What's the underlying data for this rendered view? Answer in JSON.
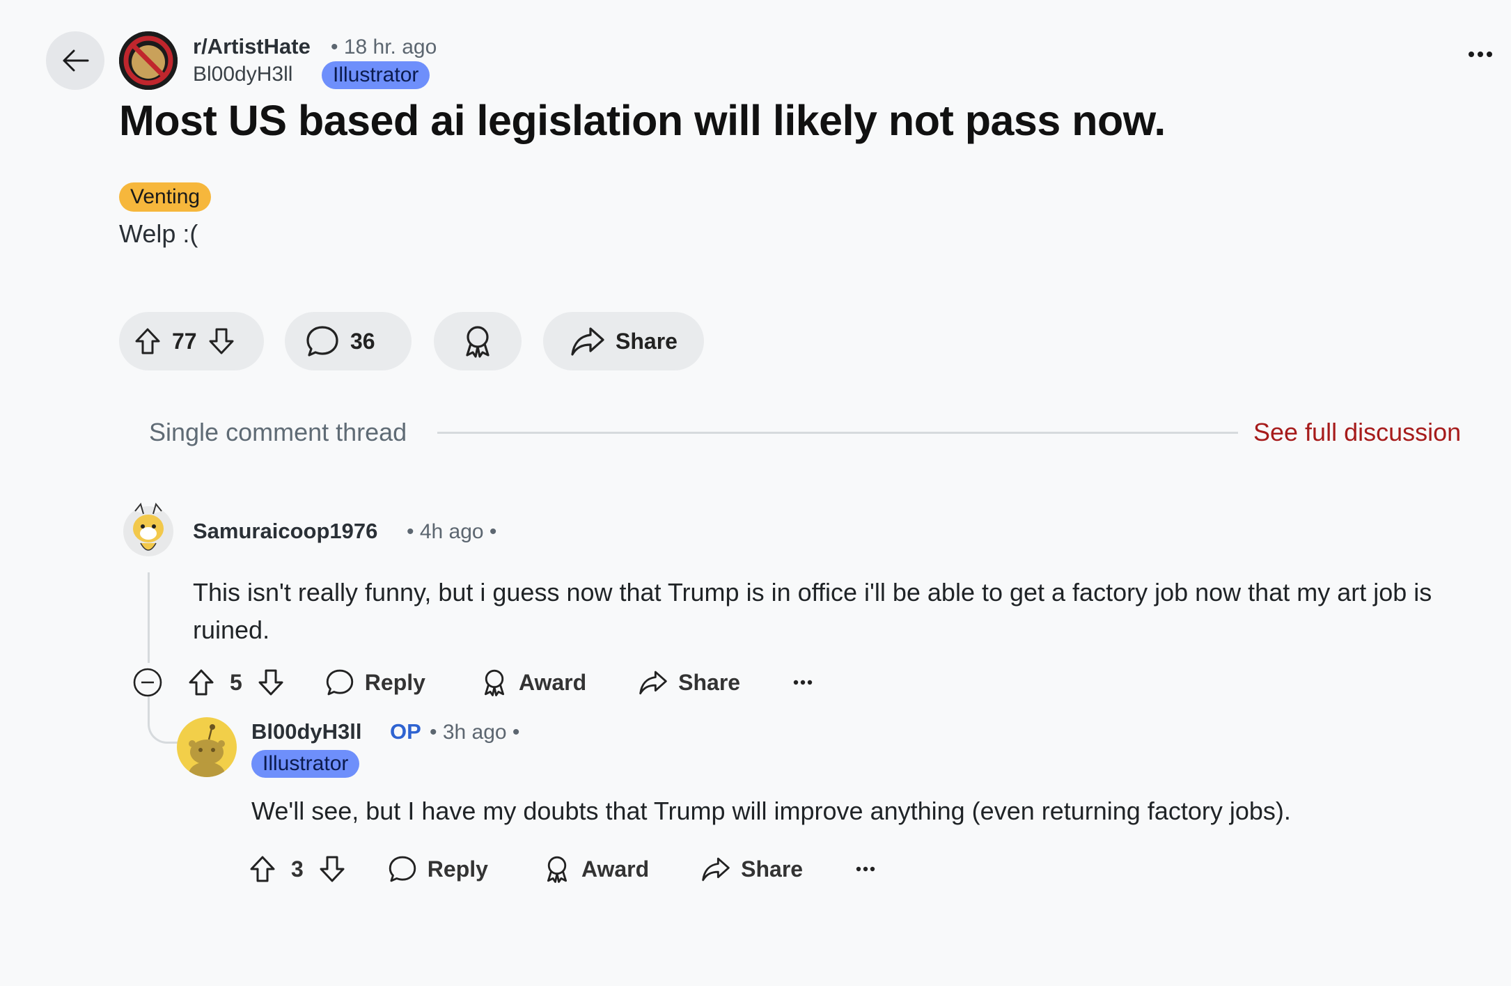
{
  "post": {
    "subreddit": "r/ArtistHate",
    "time": "• 18 hr. ago",
    "author": "Bl00dyH3ll",
    "author_flair": "Illustrator",
    "title": "Most US based ai legislation will likely not pass now.",
    "post_flair": "Venting",
    "body": "Welp :(",
    "votes": "77",
    "comments": "36",
    "share_label": "Share"
  },
  "thread": {
    "label": "Single comment thread",
    "full_discussion": "See full discussion"
  },
  "comments": [
    {
      "user": "Samuraicoop1976",
      "meta": "• 4h ago •",
      "text": "This isn't really funny, but i guess now that Trump is in office i'll be able to get a factory job now that my art job is ruined.",
      "votes": "5",
      "reply": "Reply",
      "award": "Award",
      "share": "Share"
    },
    {
      "user": "Bl00dyH3ll",
      "op": "OP",
      "meta": "• 3h ago •",
      "flair": "Illustrator",
      "text": "We'll see, but I have my doubts that Trump will improve anything (even returning factory jobs).",
      "votes": "3",
      "reply": "Reply",
      "award": "Award",
      "share": "Share"
    }
  ],
  "colors": {
    "flair_bg": "#6e8ffb",
    "venting_bg": "#f6b73c",
    "link_red": "#a61b1b",
    "op_blue": "#2e63d1"
  }
}
